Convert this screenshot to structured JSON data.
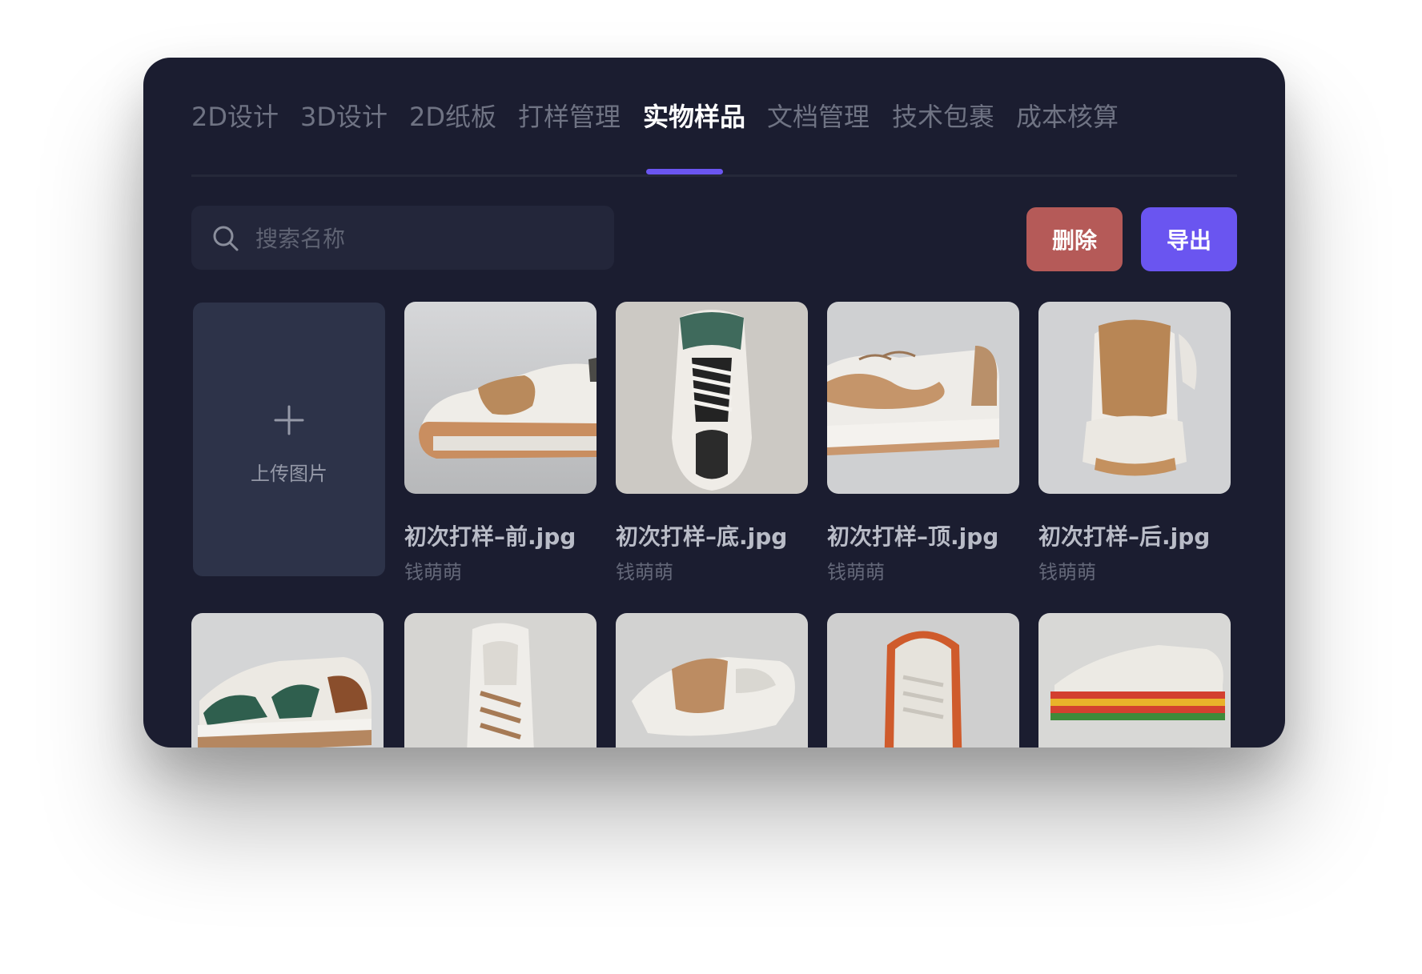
{
  "tabs": [
    {
      "label": "2D设计",
      "active": false
    },
    {
      "label": "3D设计",
      "active": false
    },
    {
      "label": "2D纸板",
      "active": false
    },
    {
      "label": "打样管理",
      "active": false
    },
    {
      "label": "实物样品",
      "active": true
    },
    {
      "label": "文档管理",
      "active": false
    },
    {
      "label": "技术包裹",
      "active": false
    },
    {
      "label": "成本核算",
      "active": false
    }
  ],
  "search": {
    "placeholder": "搜索名称",
    "value": ""
  },
  "toolbar": {
    "delete_label": "删除",
    "export_label": "导出"
  },
  "upload": {
    "label": "上传图片",
    "icon": "plus-icon"
  },
  "samples": [
    {
      "title": "初次打样–前.jpg",
      "owner": "钱萌萌"
    },
    {
      "title": "初次打样–底.jpg",
      "owner": "钱萌萌"
    },
    {
      "title": "初次打样–顶.jpg",
      "owner": "钱萌萌"
    },
    {
      "title": "初次打样–后.jpg",
      "owner": "钱萌萌"
    }
  ],
  "colors": {
    "panel": "#1b1d30",
    "accent": "#6a55f0",
    "danger": "#b55a58",
    "upload_card": "#2d3349"
  }
}
